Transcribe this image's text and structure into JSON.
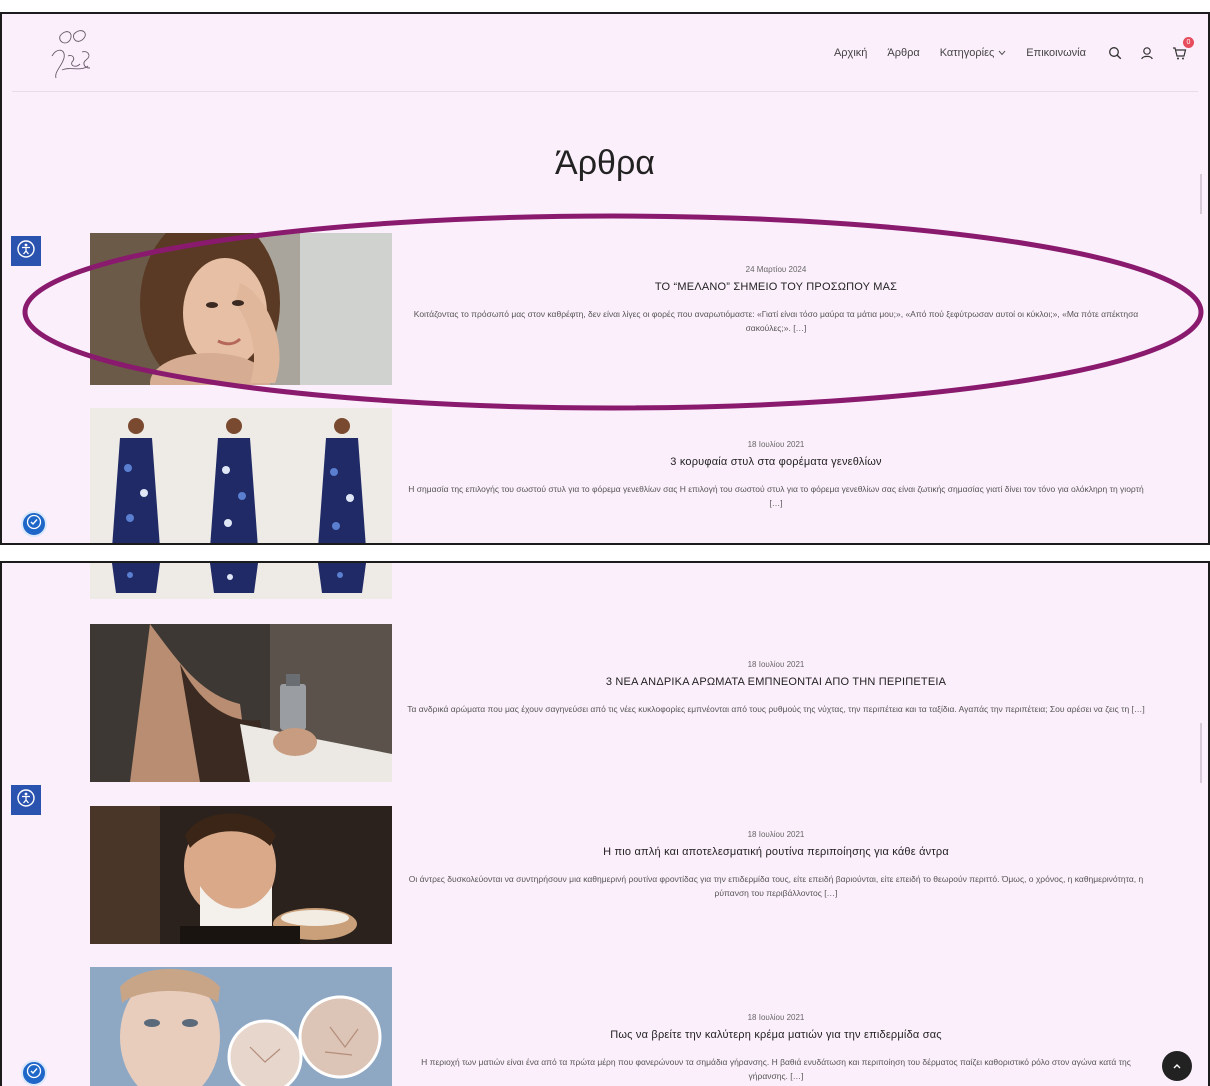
{
  "nav": {
    "items": [
      {
        "label": "Αρχική"
      },
      {
        "label": "Άρθρα"
      },
      {
        "label": "Κατηγορίες"
      },
      {
        "label": "Επικοινωνία"
      }
    ],
    "cart_count": "0"
  },
  "page": {
    "title": "Άρθρα"
  },
  "articles": [
    {
      "date": "24 Μαρτίου 2024",
      "title": "ΤΟ “ΜΕΛΑΝΟ” ΣΗΜΕΙΟ ΤΟΥ ΠΡΟΣΩΠΟΥ ΜΑΣ",
      "excerpt": "Κοιτάζοντας το πρόσωπό μας στον καθρέφτη, δεν είναι λίγες οι φορές που αναρωτιόμαστε: «Γιατί είναι τόσο μαύρα τα μάτια μου;», «Από πού ξεφύτρωσαν αυτοί οι κύκλοι;», «Μα πότε απέκτησα σακούλες;». […]"
    },
    {
      "date": "18 Ιουλίου 2021",
      "title": "3 κορυφαία στυλ στα φορέματα γενεθλίων",
      "excerpt": "Η σημασία της επιλογής του σωστού στυλ για το φόρεμα γενεθλίων σας Η επιλογή του σωστού στυλ για το φόρεμα γενεθλίων σας είναι ζωτικής σημασίας γιατί δίνει τον τόνο για ολόκληρη τη γιορτή […]"
    },
    {
      "date": "18 Ιουλίου 2021",
      "title": "3 ΝΕΑ ΑΝΔΡΙΚΑ ΑΡΩΜΑΤΑ ΕΜΠΝΕΟΝΤΑΙ ΑΠΟ ΤΗΝ ΠΕΡΙΠΕΤΕΙΑ",
      "excerpt": "Τα ανδρικά αρώματα που μας έχουν σαγηνεύσει από τις νέες κυκλοφορίες εμπνέονται από τους ρυθμούς της νύχτας, την περιπέτεια και τα ταξίδια. Αγαπάς την περιπέτεια; Σου αρέσει να ζεις τη […]"
    },
    {
      "date": "18 Ιουλίου 2021",
      "title": "Η πιο απλή και αποτελεσματική ρουτίνα περιποίησης για κάθε άντρα",
      "excerpt": "Οι άντρες δυσκολεύονται να συντηρήσουν μια καθημερινή ρουτίνα φροντίδας για την επιδερμίδα τους, είτε επειδή βαριούνται, είτε επειδή το θεωρούν περιττό. Όμως, ο χρόνος, η καθημερινότητα, η ρύπανση του περιβάλλοντος […]"
    },
    {
      "date": "18 Ιουλίου 2021",
      "title": "Πως να βρείτε την καλύτερη κρέμα ματιών για την επιδερμίδα σας",
      "excerpt": "Η περιοχή των ματιών είναι ένα από τα πρώτα μέρη που φανερώνουν τα σημάδια γήρανσης. Η βαθιά ενυδάτωση και περιποίηση του δέρματος παίζει καθοριστικό ρόλο στον αγώνα κατά της γήρανσης. […]"
    }
  ],
  "icons": {
    "search": "search-icon",
    "account": "user-icon",
    "cart": "cart-icon",
    "accessibility": "accessibility-icon",
    "scroll_top": "chevron-up-icon"
  },
  "colors": {
    "page_bg": "#fbeffb",
    "highlight": "#8a1a6e",
    "a11y_blue": "#2a53b0"
  }
}
